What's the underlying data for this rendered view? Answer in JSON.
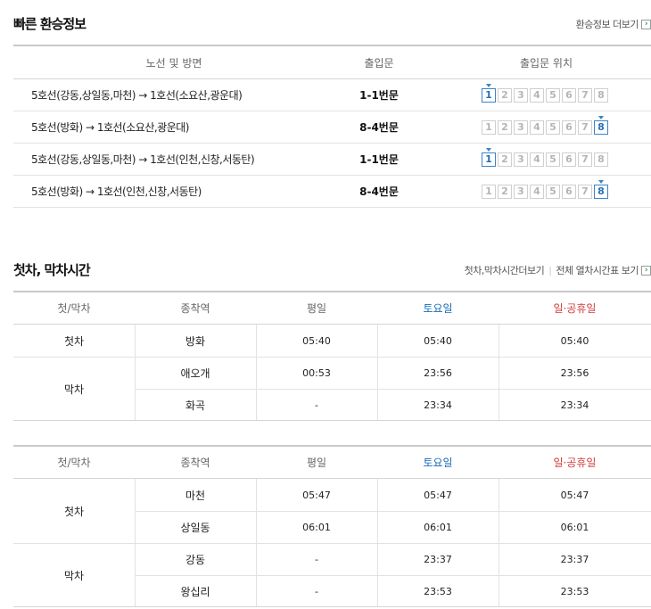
{
  "transfer": {
    "title": "빠른 환승정보",
    "more_label": "환승정보 더보기",
    "headers": {
      "route": "노선 및 방면",
      "gate": "출입문",
      "position": "출입문 위치"
    },
    "door_numbers": [
      "1",
      "2",
      "3",
      "4",
      "5",
      "6",
      "7",
      "8"
    ],
    "rows": [
      {
        "route": "5호선(강동,상일동,마천) → 1호선(소요산,광운대)",
        "gate": "1-1번문",
        "active_door": 1
      },
      {
        "route": "5호선(방화) → 1호선(소요산,광운대)",
        "gate": "8-4번문",
        "active_door": 8
      },
      {
        "route": "5호선(강동,상일동,마천) → 1호선(인천,신창,서동탄)",
        "gate": "1-1번문",
        "active_door": 1
      },
      {
        "route": "5호선(방화) → 1호선(인천,신창,서동탄)",
        "gate": "8-4번문",
        "active_door": 8
      }
    ]
  },
  "times": {
    "title": "첫차, 막차시간",
    "link1": "첫차,막차시간더보기",
    "link2": "전체 열차시간표 보기",
    "headers": {
      "type": "첫/막차",
      "station": "종착역",
      "weekday": "평일",
      "saturday": "토요일",
      "holiday": "일·공휴일"
    },
    "table1": {
      "first_label": "첫차",
      "last_label": "막차",
      "rows": [
        {
          "station": "방화",
          "weekday": "05:40",
          "saturday": "05:40",
          "holiday": "05:40"
        },
        {
          "station": "애오개",
          "weekday": "00:53",
          "saturday": "23:56",
          "holiday": "23:56"
        },
        {
          "station": "화곡",
          "weekday": "-",
          "saturday": "23:34",
          "holiday": "23:34"
        }
      ]
    },
    "table2": {
      "first_label": "첫차",
      "last_label": "막차",
      "rows": [
        {
          "station": "마천",
          "weekday": "05:47",
          "saturday": "05:47",
          "holiday": "05:47"
        },
        {
          "station": "상일동",
          "weekday": "06:01",
          "saturday": "06:01",
          "holiday": "06:01"
        },
        {
          "station": "강동",
          "weekday": "-",
          "saturday": "23:37",
          "holiday": "23:37"
        },
        {
          "station": "왕십리",
          "weekday": "-",
          "saturday": "23:53",
          "holiday": "23:53"
        }
      ]
    }
  },
  "colors": {
    "blue": "#1a6bb8",
    "red": "#d23c3c",
    "door_active": "#3a84c8"
  }
}
